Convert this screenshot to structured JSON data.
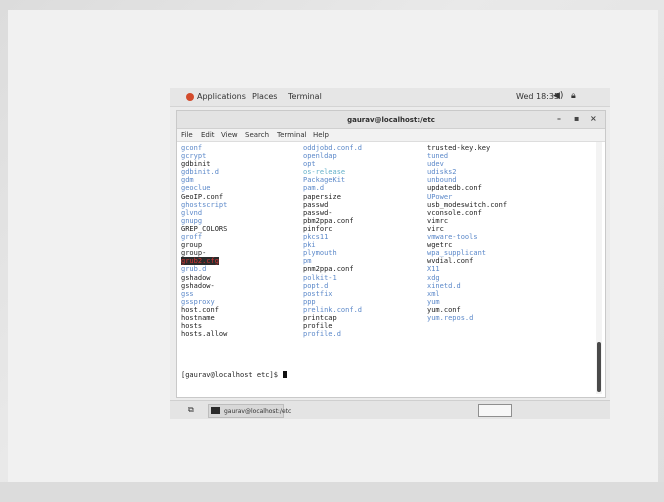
{
  "topbar": {
    "applications": "Applications",
    "places": "Places",
    "terminal": "Terminal",
    "clock": "Wed 18:35",
    "icons": [
      "speaker-icon",
      "lock-icon"
    ]
  },
  "window": {
    "title": "gaurav@localhost:/etc",
    "menu": {
      "file": "File",
      "edit": "Edit",
      "view": "View",
      "search": "Search",
      "terminal": "Terminal",
      "help": "Help"
    },
    "buttons": {
      "minimize": "–",
      "maximize": "▪",
      "close": "×"
    }
  },
  "terminal": {
    "colors": {
      "dir": "#5b88c9",
      "link": "#63b0c9",
      "file": "#222222",
      "highlight_bg": "#2b2b2b",
      "highlight_fg": "#d43232"
    },
    "col1": [
      {
        "text": "gconf",
        "kind": "dir"
      },
      {
        "text": "gcrypt",
        "kind": "dir"
      },
      {
        "text": "gdbinit",
        "kind": "file"
      },
      {
        "text": "gdbinit.d",
        "kind": "dir"
      },
      {
        "text": "gdm",
        "kind": "dir"
      },
      {
        "text": "geoclue",
        "kind": "dir"
      },
      {
        "text": "GeoIP.conf",
        "kind": "file"
      },
      {
        "text": "ghostscript",
        "kind": "dir"
      },
      {
        "text": "glvnd",
        "kind": "dir"
      },
      {
        "text": "gnupg",
        "kind": "dir"
      },
      {
        "text": "GREP_COLORS",
        "kind": "file"
      },
      {
        "text": "groff",
        "kind": "dir"
      },
      {
        "text": "group",
        "kind": "file"
      },
      {
        "text": "group-",
        "kind": "file"
      },
      {
        "text": "grub2.cfg",
        "kind": "highlight"
      },
      {
        "text": "grub.d",
        "kind": "dir"
      },
      {
        "text": "gshadow",
        "kind": "file"
      },
      {
        "text": "gshadow-",
        "kind": "file"
      },
      {
        "text": "gss",
        "kind": "dir"
      },
      {
        "text": "gssproxy",
        "kind": "dir"
      },
      {
        "text": "host.conf",
        "kind": "file"
      },
      {
        "text": "hostname",
        "kind": "file"
      },
      {
        "text": "hosts",
        "kind": "file"
      },
      {
        "text": "hosts.allow",
        "kind": "file"
      }
    ],
    "col2": [
      {
        "text": "oddjobd.conf.d",
        "kind": "dir"
      },
      {
        "text": "openldap",
        "kind": "dir"
      },
      {
        "text": "opt",
        "kind": "dir"
      },
      {
        "text": "os-release",
        "kind": "link"
      },
      {
        "text": "PackageKit",
        "kind": "dir"
      },
      {
        "text": "pam.d",
        "kind": "dir"
      },
      {
        "text": "papersize",
        "kind": "file"
      },
      {
        "text": "passwd",
        "kind": "file"
      },
      {
        "text": "passwd-",
        "kind": "file"
      },
      {
        "text": "pbm2ppa.conf",
        "kind": "file"
      },
      {
        "text": "pinforc",
        "kind": "file"
      },
      {
        "text": "pkcs11",
        "kind": "dir"
      },
      {
        "text": "pki",
        "kind": "dir"
      },
      {
        "text": "plymouth",
        "kind": "dir"
      },
      {
        "text": "pm",
        "kind": "dir"
      },
      {
        "text": "pnm2ppa.conf",
        "kind": "file"
      },
      {
        "text": "polkit-1",
        "kind": "dir"
      },
      {
        "text": "popt.d",
        "kind": "dir"
      },
      {
        "text": "postfix",
        "kind": "dir"
      },
      {
        "text": "ppp",
        "kind": "dir"
      },
      {
        "text": "prelink.conf.d",
        "kind": "dir"
      },
      {
        "text": "printcap",
        "kind": "file"
      },
      {
        "text": "profile",
        "kind": "file"
      },
      {
        "text": "profile.d",
        "kind": "dir"
      }
    ],
    "col3": [
      {
        "text": "trusted-key.key",
        "kind": "file"
      },
      {
        "text": "tuned",
        "kind": "dir"
      },
      {
        "text": "udev",
        "kind": "dir"
      },
      {
        "text": "udisks2",
        "kind": "dir"
      },
      {
        "text": "unbound",
        "kind": "dir"
      },
      {
        "text": "updatedb.conf",
        "kind": "file"
      },
      {
        "text": "UPower",
        "kind": "dir"
      },
      {
        "text": "usb_modeswitch.conf",
        "kind": "file"
      },
      {
        "text": "vconsole.conf",
        "kind": "file"
      },
      {
        "text": "vimrc",
        "kind": "file"
      },
      {
        "text": "virc",
        "kind": "file"
      },
      {
        "text": "vmware-tools",
        "kind": "dir"
      },
      {
        "text": "wgetrc",
        "kind": "file"
      },
      {
        "text": "wpa_supplicant",
        "kind": "dir"
      },
      {
        "text": "wvdial.conf",
        "kind": "file"
      },
      {
        "text": "X11",
        "kind": "dir"
      },
      {
        "text": "xdg",
        "kind": "dir"
      },
      {
        "text": "xinetd.d",
        "kind": "dir"
      },
      {
        "text": "xml",
        "kind": "dir"
      },
      {
        "text": "yum",
        "kind": "dir"
      },
      {
        "text": "yum.conf",
        "kind": "file"
      },
      {
        "text": "yum.repos.d",
        "kind": "dir"
      }
    ],
    "prompt": "[gaurav@localhost etc]$ "
  },
  "taskbar": {
    "task_label": "gaurav@localhost:/etc"
  }
}
